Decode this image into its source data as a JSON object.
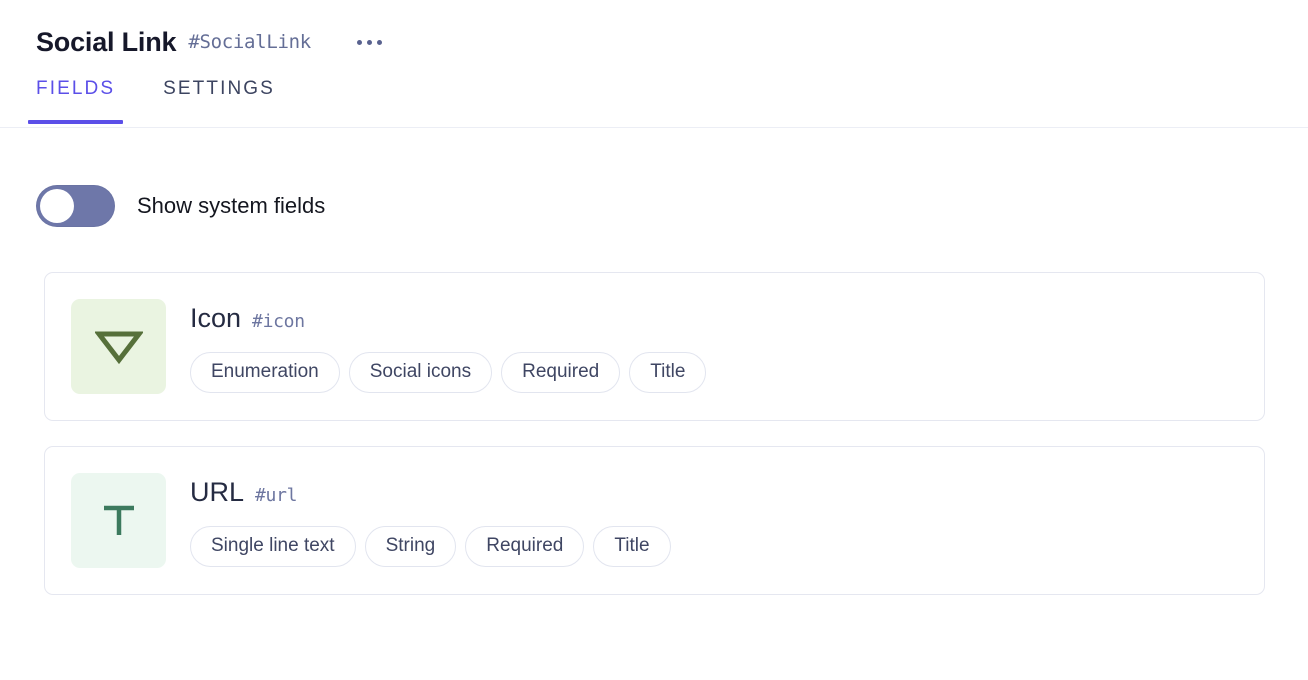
{
  "header": {
    "title": "Social Link",
    "slug": "#SocialLink",
    "menu_icon": "more-horizontal-icon"
  },
  "tabs": [
    {
      "label": "FIELDS",
      "active": true
    },
    {
      "label": "SETTINGS",
      "active": false
    }
  ],
  "toggle": {
    "label": "Show system fields",
    "state": "off",
    "track_color": "#6e77a9",
    "knob_color": "#ffffff"
  },
  "fields": [
    {
      "name": "Icon",
      "slug": "#icon",
      "icon": "enumeration-triangle-icon",
      "icon_bg": "#eaf4e1",
      "icon_color": "#56703a",
      "tags": [
        "Enumeration",
        "Social icons",
        "Required",
        "Title"
      ]
    },
    {
      "name": "URL",
      "slug": "#url",
      "icon": "text-t-icon",
      "icon_bg": "#ecf7f0",
      "icon_color": "#3c7a5e",
      "tags": [
        "Single line text",
        "String",
        "Required",
        "Title"
      ]
    }
  ],
  "theme": {
    "accent": "#5b4fe8",
    "border": "#e5e7f0",
    "text_primary": "#16182a",
    "text_muted": "#646e96"
  }
}
